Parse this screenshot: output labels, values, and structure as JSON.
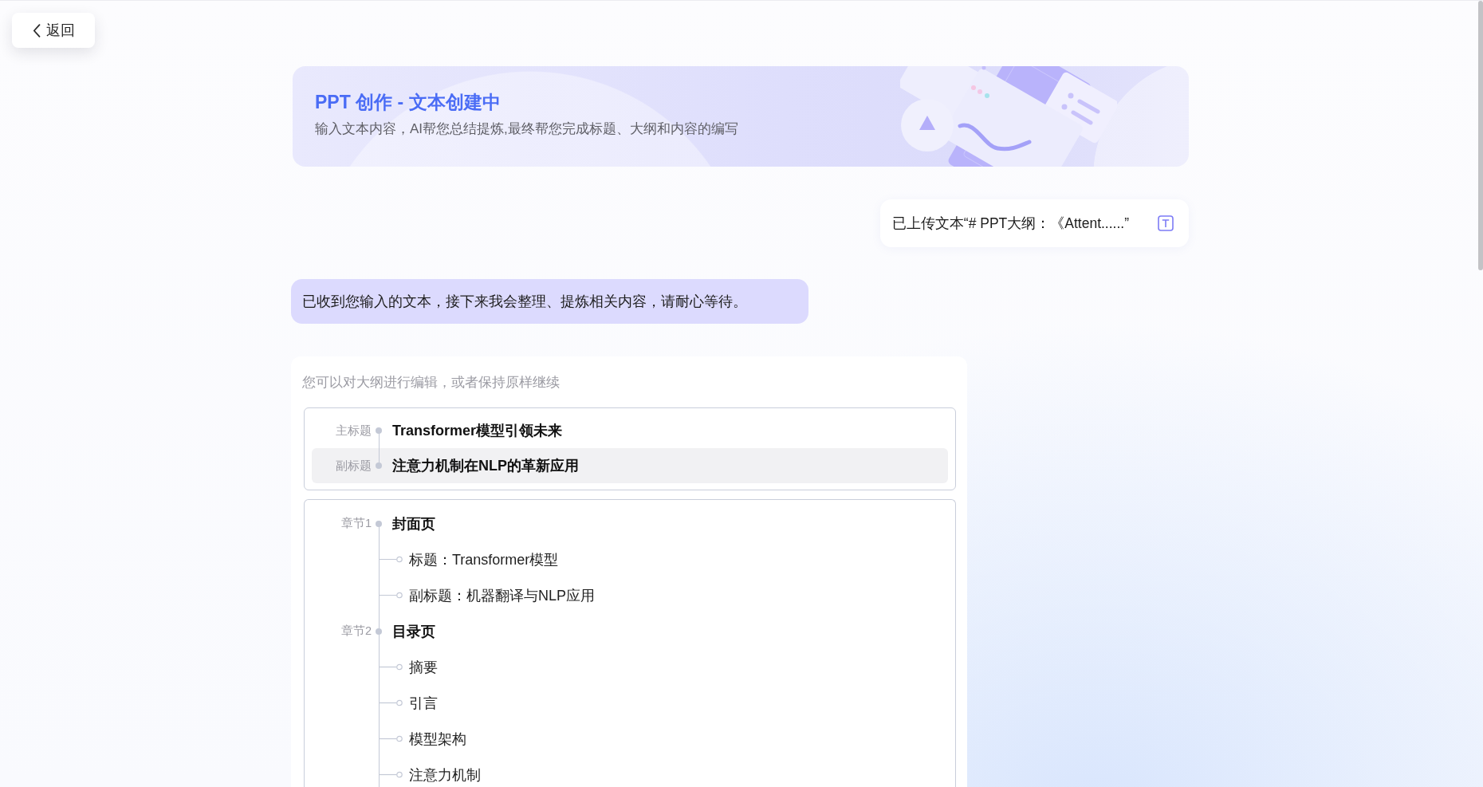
{
  "back_button": {
    "label": "返回"
  },
  "banner": {
    "title": "PPT 创作 - 文本创建中",
    "subtitle": "输入文本内容，AI帮您总结提炼,最终帮您完成标题、大纲和内容的编写"
  },
  "messages": [
    {
      "kind": "upload",
      "text": "已上传文本“# PPT大纲：《Attent......”"
    },
    {
      "kind": "reply",
      "text": "已收到您输入的文本，接下来我会整理、提炼相关内容，请耐心等待。"
    }
  ],
  "outline": {
    "hint": "您可以对大纲进行编辑，或者保持原样继续",
    "titles": [
      {
        "label": "主标题",
        "text": "Transformer模型引领未来",
        "selected": false
      },
      {
        "label": "副标题",
        "text": "注意力机制在NLP的革新应用",
        "selected": true
      }
    ],
    "chapters": [
      {
        "label": "章节1",
        "title": "封面页",
        "children": [
          {
            "text": "标题：Transformer模型"
          },
          {
            "text": "副标题：机器翻译与NLP应用"
          }
        ]
      },
      {
        "label": "章节2",
        "title": "目录页",
        "children": [
          {
            "text": "摘要"
          },
          {
            "text": "引言"
          },
          {
            "text": "模型架构"
          },
          {
            "text": "注意力机制"
          }
        ]
      }
    ]
  }
}
